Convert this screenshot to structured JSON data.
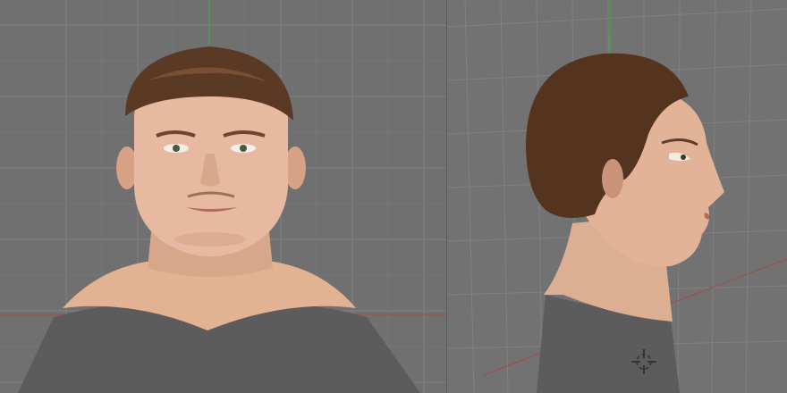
{
  "app": {
    "title": ""
  },
  "viewports": [
    {
      "id": "front",
      "view": "front-orthographic"
    },
    {
      "id": "side",
      "view": "right-perspective"
    }
  ],
  "scene": {
    "object": "head-bust-model",
    "grid_visible": true,
    "colors": {
      "background": "#707070",
      "grid": "#7d7d7d",
      "axis_green": "#4f9a4f",
      "axis_red": "#a84a4a",
      "skin": "#e4b79d",
      "skin_shadow": "#c8977c",
      "hair": "#5b3a25",
      "shirt": "#5c5c5c"
    }
  },
  "icons": {
    "cursor": "3d-cursor-icon"
  }
}
